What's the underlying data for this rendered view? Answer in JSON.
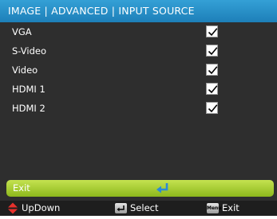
{
  "window": {
    "title": "IMAGE | ADVANCED | INPUT SOURCE"
  },
  "sources": [
    {
      "label": "VGA",
      "checked": true
    },
    {
      "label": "S-Video",
      "checked": true
    },
    {
      "label": "Video",
      "checked": true
    },
    {
      "label": "HDMI 1",
      "checked": true
    },
    {
      "label": "HDMI 2",
      "checked": true
    }
  ],
  "exit_bar": {
    "label": "Exit",
    "icon": "enter-arrow-icon"
  },
  "footer": {
    "updown": {
      "label": "UpDown",
      "icon": "up-down-arrows-icon"
    },
    "select": {
      "label": "Select",
      "icon": "enter-key-icon"
    },
    "exit": {
      "label": "Exit",
      "icon": "menu-key-icon",
      "key_text": "Menu"
    }
  },
  "colors": {
    "title_bar": "#2a92c9",
    "background": "#2e2e2e",
    "highlight": "#a8cc34",
    "footer": "#1e1e1e",
    "accent_arrow": "#2c8ad6",
    "updown_arrows": "#e8312c"
  }
}
